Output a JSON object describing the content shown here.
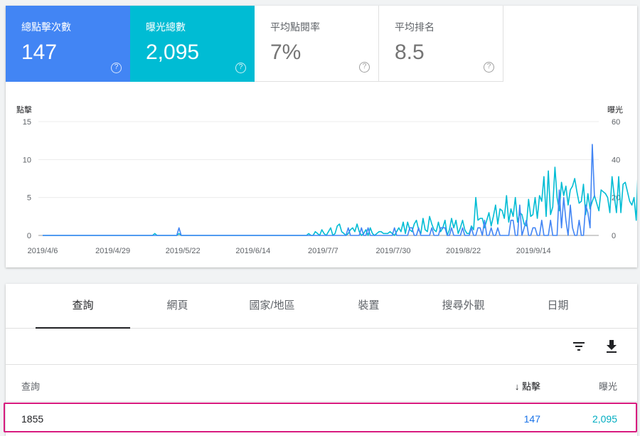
{
  "metrics": [
    {
      "label": "總點擊次數",
      "value": "147"
    },
    {
      "label": "曝光總數",
      "value": "2,095"
    },
    {
      "label": "平均點閱率",
      "value": "7%"
    },
    {
      "label": "平均排名",
      "value": "8.5"
    }
  ],
  "help_glyph": "?",
  "colors": {
    "clicks": "#4285f4",
    "impressions": "#00bcd4",
    "highlight": "#d81b7f"
  },
  "chart_data": {
    "type": "line",
    "y_left_label": "點擊",
    "y_right_label": "曝光",
    "y_left_ticks": [
      "0",
      "5",
      "10",
      "15"
    ],
    "y_right_ticks": [
      "0",
      "20",
      "40",
      "60"
    ],
    "ylim_left": [
      0,
      15
    ],
    "ylim_right": [
      0,
      60
    ],
    "x_tick_labels": [
      "2019/4/6",
      "2019/4/29",
      "2019/5/22",
      "2019/6/14",
      "2019/7/7",
      "2019/7/30",
      "2019/8/22",
      "2019/9/14"
    ],
    "grid": true,
    "series": [
      {
        "name": "點擊",
        "axis": "left",
        "values": [
          0,
          0,
          0,
          0,
          0,
          0,
          0,
          0,
          0,
          0,
          0,
          0,
          0,
          0,
          0,
          0,
          0,
          0,
          0,
          0,
          0,
          0,
          0,
          0,
          0,
          0,
          0,
          0,
          0,
          0,
          0,
          0,
          0,
          0,
          0,
          0,
          0,
          0,
          0,
          0,
          0,
          0,
          0,
          0,
          0,
          0,
          0,
          0,
          0,
          0,
          0,
          0,
          0,
          0,
          0,
          0,
          0,
          0,
          0,
          0,
          0,
          0,
          1,
          0,
          0,
          0,
          0,
          0,
          0,
          0,
          0,
          0,
          0,
          0,
          0,
          0,
          0,
          0,
          0,
          0,
          0,
          0,
          0,
          0,
          0,
          0,
          0,
          0,
          0,
          0,
          0,
          0,
          0,
          0,
          0,
          0,
          0,
          0,
          0,
          0,
          0,
          0,
          0,
          0,
          0,
          0,
          0,
          0,
          0,
          0,
          0,
          0,
          0,
          0,
          0,
          0,
          0,
          0,
          0,
          0,
          0,
          0,
          0,
          0,
          0,
          0,
          0,
          0,
          0,
          0,
          0,
          0,
          0,
          0,
          0,
          0,
          0,
          0,
          0,
          1,
          0,
          0,
          0,
          0,
          0,
          1,
          0,
          0,
          1,
          0,
          0,
          0,
          0,
          0,
          0,
          0,
          0,
          0,
          0,
          0,
          1,
          0,
          0,
          0,
          0,
          0,
          0,
          1,
          1,
          0,
          0,
          1,
          0,
          0,
          0,
          0,
          0,
          1,
          0,
          0,
          0,
          1,
          1,
          1,
          0,
          0,
          1,
          0,
          0,
          0,
          0,
          1,
          0,
          0,
          0,
          1,
          0,
          0,
          1,
          1,
          0,
          2,
          0,
          0,
          1,
          0,
          0,
          1,
          0,
          0,
          0,
          0,
          0,
          2,
          2,
          0,
          0,
          4,
          0,
          1,
          2,
          0,
          0,
          1,
          1,
          0,
          0,
          2,
          0,
          0,
          0,
          2,
          0,
          0,
          0,
          6,
          1,
          5,
          2,
          0,
          4,
          1,
          0,
          0,
          2,
          0,
          0,
          4,
          3,
          1,
          12,
          5
        ]
      },
      {
        "name": "曝光",
        "axis": "right",
        "values": [
          0,
          0,
          0,
          0,
          0,
          0,
          0,
          0,
          0,
          0,
          0,
          0,
          0,
          0,
          0,
          0,
          0,
          0,
          0,
          0,
          0,
          0,
          0,
          0,
          0,
          0,
          0,
          0,
          0,
          0,
          0,
          0,
          0,
          0,
          0,
          0,
          0,
          0,
          0,
          0,
          0,
          0,
          0,
          0,
          0,
          0,
          0,
          0,
          0,
          0,
          0,
          1,
          0,
          0,
          0,
          0,
          0,
          0,
          0,
          0,
          0,
          0,
          1,
          0,
          0,
          0,
          0,
          0,
          0,
          0,
          0,
          0,
          0,
          0,
          0,
          0,
          0,
          0,
          0,
          0,
          0,
          0,
          0,
          0,
          0,
          0,
          0,
          0,
          0,
          0,
          0,
          0,
          0,
          0,
          0,
          0,
          0,
          0,
          0,
          0,
          0,
          0,
          0,
          0,
          0,
          0,
          0,
          0,
          0,
          0,
          0,
          0,
          0,
          0,
          0,
          0,
          0,
          0,
          0,
          0,
          0,
          1,
          0,
          0,
          2,
          1,
          0,
          3,
          1,
          0,
          2,
          4,
          0,
          1,
          5,
          6,
          2,
          1,
          0,
          1,
          3,
          4,
          2,
          6,
          2,
          0,
          1,
          3,
          0,
          4,
          1,
          0,
          1,
          2,
          2,
          1,
          1,
          1,
          2,
          1,
          0,
          2,
          4,
          2,
          7,
          1,
          7,
          3,
          2,
          6,
          8,
          3,
          1,
          9,
          3,
          2,
          10,
          6,
          3,
          2,
          7,
          2,
          4,
          8,
          0,
          3,
          9,
          4,
          8,
          1,
          4,
          8,
          3,
          1,
          1,
          5,
          3,
          20,
          8,
          9,
          9,
          4,
          8,
          12,
          5,
          10,
          16,
          6,
          14,
          13,
          9,
          21,
          7,
          14,
          10,
          20,
          7,
          12,
          11,
          6,
          5,
          19,
          10,
          11,
          20,
          9,
          21,
          18,
          31,
          10,
          34,
          11,
          15,
          36,
          20,
          13,
          28,
          21,
          26,
          16,
          24,
          26,
          30,
          23,
          17,
          18,
          27,
          11,
          22,
          14,
          18,
          21,
          17,
          13,
          24,
          23,
          22,
          20,
          12,
          31,
          21,
          12,
          31,
          12,
          27,
          28,
          23,
          18,
          16,
          20,
          8,
          40,
          22,
          27,
          14,
          26
        ]
      }
    ]
  },
  "tabs": [
    "查詢",
    "網頁",
    "國家/地區",
    "裝置",
    "搜尋外觀",
    "日期"
  ],
  "toolbar": {
    "filter_icon": "filter-icon",
    "download_icon": "download-icon"
  },
  "table": {
    "columns": [
      "查詢",
      "點擊",
      "曝光"
    ],
    "sort_arrow": "↓",
    "rows": [
      {
        "query": "1855",
        "clicks": "147",
        "impressions": "2,095"
      }
    ]
  }
}
